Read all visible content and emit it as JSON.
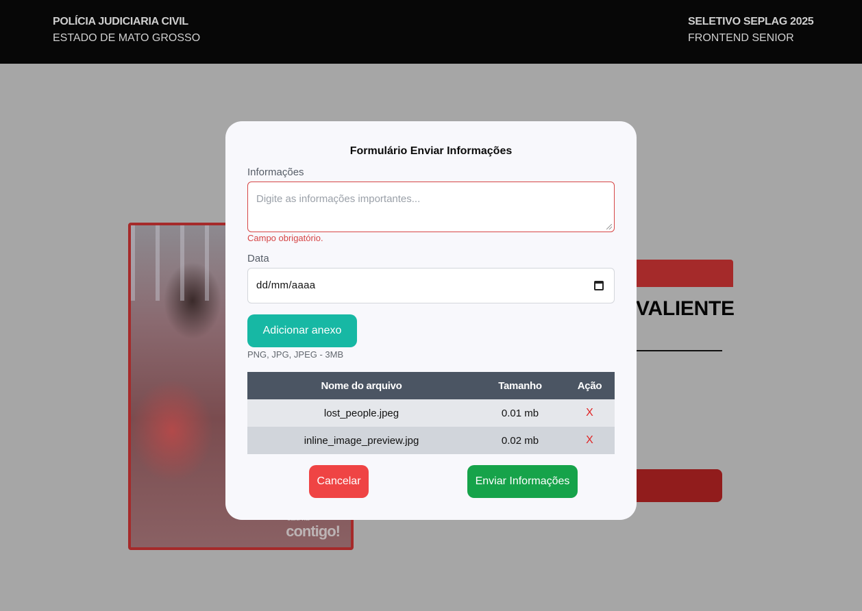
{
  "header": {
    "org_title": "POLÍCIA JUDICIARIA CIVIL",
    "org_subtitle": "ESTADO DE MATO GROSSO",
    "project_title": "SELETIVO SEPLAG 2025",
    "project_subtitle": "FRONTEND SENIOR"
  },
  "background": {
    "person_name_partial": "VALIENTE",
    "photo_watermark_small": "saiu na",
    "photo_watermark": "contigo!"
  },
  "modal": {
    "title": "Formulário Enviar Informações",
    "info_label": "Informações",
    "info_placeholder": "Digite as informações importantes...",
    "info_error": "Campo obrigatório.",
    "date_label": "Data",
    "date_value": "dd/mm/aaaa",
    "attach_button": "Adicionar anexo",
    "attach_hint": "PNG, JPG, JPEG - 3MB",
    "table": {
      "headers": [
        "Nome do arquivo",
        "Tamanho",
        "Ação"
      ],
      "rows": [
        {
          "name": "lost_people.jpeg",
          "size": "0.01 mb",
          "action": "X"
        },
        {
          "name": "inline_image_preview.jpg",
          "size": "0.02 mb",
          "action": "X"
        }
      ]
    },
    "cancel_button": "Cancelar",
    "submit_button": "Enviar Informações"
  },
  "colors": {
    "header_bg": "#070707",
    "overlay_bg": "#a6a6a6",
    "accent_red": "#a52a2a",
    "attach_teal": "#17b8a4",
    "cancel_red": "#ef4444",
    "submit_green": "#16a34a",
    "error_red": "#d64545"
  }
}
